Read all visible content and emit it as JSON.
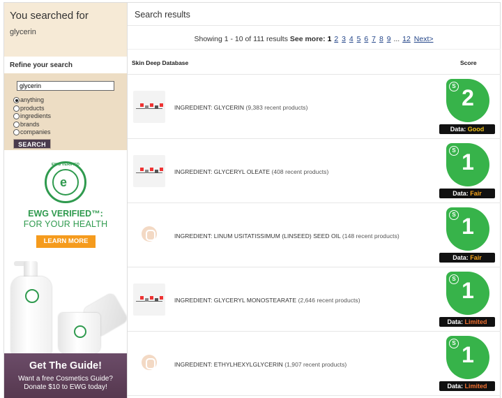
{
  "sidebar": {
    "searched_heading": "You searched for",
    "query": "glycerin",
    "refine_title": "Refine your search",
    "search_input_value": "glycerin",
    "options": [
      {
        "label": "anything",
        "selected": true
      },
      {
        "label": "products",
        "selected": false
      },
      {
        "label": "ingredients",
        "selected": false
      },
      {
        "label": "brands",
        "selected": false
      },
      {
        "label": "companies",
        "selected": false
      }
    ],
    "search_button": "SEARCH"
  },
  "ad": {
    "seal_text": "EWG VERIFIED",
    "title": "EWG VERIFIED™:",
    "subtitle": "FOR YOUR HEALTH",
    "learn_more": "LEARN MORE",
    "guide_title": "Get The Guide!",
    "guide_line1": "Want a free Cosmetics Guide?",
    "guide_line2": "Donate $10 to EWG today!"
  },
  "main": {
    "title": "Search results",
    "pager": {
      "showing": "Showing 1 - 10 of 111 results",
      "see_more": "See more:",
      "current": "1",
      "pages": [
        "2",
        "3",
        "4",
        "5",
        "6",
        "7",
        "8",
        "9"
      ],
      "ellipsis": "...",
      "last": "12",
      "next": "Next>"
    },
    "col_db": "Skin Deep Database",
    "col_score": "Score",
    "data_label": "Data:",
    "results": [
      {
        "name": "INGREDIENT: GLYCERIN",
        "count": "(9,383 recent products)",
        "score": "2",
        "data": "Good",
        "level": "good",
        "thumb": "molecule"
      },
      {
        "name": "INGREDIENT: GLYCERYL OLEATE",
        "count": "(408 recent products)",
        "score": "1",
        "data": "Fair",
        "level": "fair",
        "thumb": "molecule"
      },
      {
        "name": "INGREDIENT: LINUM USITATISSIMUM (LINSEED) SEED OIL",
        "count": "(148 recent products)",
        "score": "1",
        "data": "Fair",
        "level": "fair",
        "thumb": "placeholder"
      },
      {
        "name": "INGREDIENT: GLYCERYL MONOSTEARATE",
        "count": "(2,646 recent products)",
        "score": "1",
        "data": "Limited",
        "level": "limited",
        "thumb": "molecule"
      },
      {
        "name": "INGREDIENT: ETHYLHEXYLGLYCERIN",
        "count": "(1,907 recent products)",
        "score": "1",
        "data": "Limited",
        "level": "limited",
        "thumb": "placeholder"
      }
    ]
  },
  "colors": {
    "score_green": "#37b34a",
    "sidebar_beige": "#f6ead6",
    "refine_beige": "#edddc4",
    "guide_purple": "#5e4059",
    "ewg_green": "#2f9a4e",
    "learn_orange": "#f59b1d"
  }
}
